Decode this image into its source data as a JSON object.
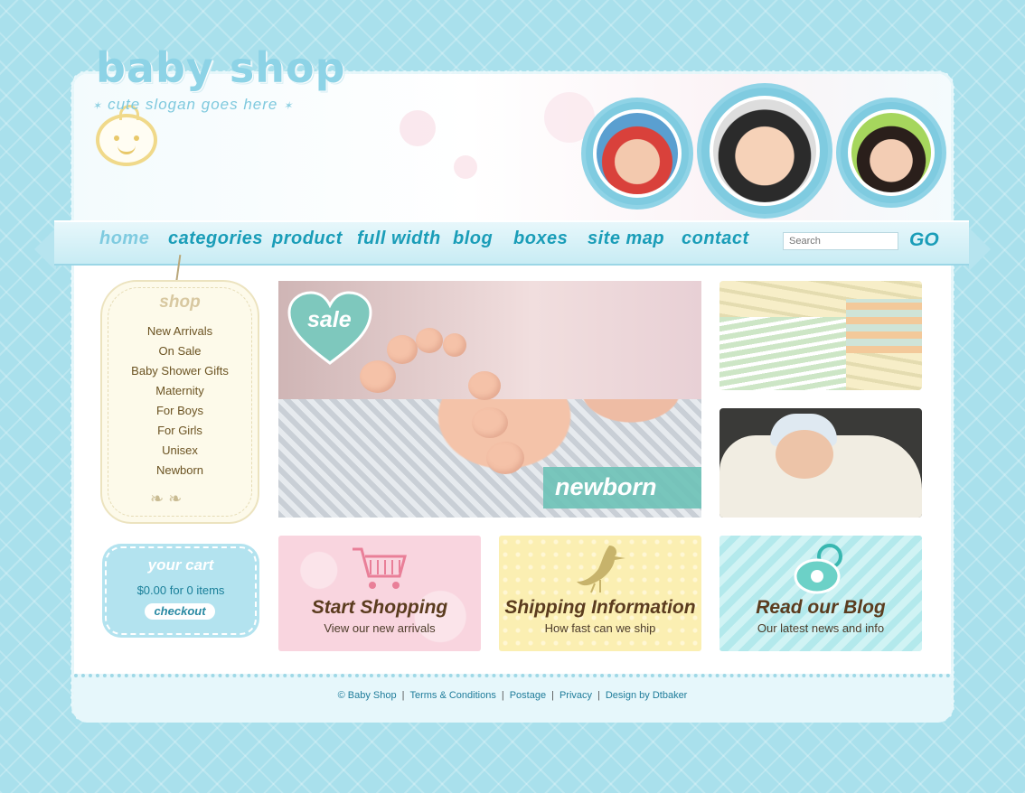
{
  "brand": {
    "title": "baby shop",
    "slogan": "cute slogan goes here"
  },
  "nav": {
    "items": [
      "home",
      "categories",
      "product",
      "full width",
      "blog",
      "boxes",
      "site map",
      "contact"
    ],
    "active": "home",
    "search_placeholder": "Search",
    "go_label": "GO"
  },
  "shop": {
    "title": "shop",
    "links": [
      "New Arrivals",
      "On Sale",
      "Baby Shower Gifts",
      "Maternity",
      "For Boys",
      "For Girls",
      "Unisex",
      "Newborn"
    ]
  },
  "cart": {
    "title": "your cart",
    "summary": "$0.00 for 0 items",
    "checkout_label": "checkout"
  },
  "hero": {
    "badge": "sale",
    "caption": "newborn"
  },
  "promos": [
    {
      "title": "Start Shopping",
      "subtitle": "View our new arrivals",
      "icon": "shopping-cart-icon"
    },
    {
      "title": "Shipping Information",
      "subtitle": "How fast can we ship",
      "icon": "stork-icon"
    },
    {
      "title": "Read our Blog",
      "subtitle": "Our latest news and info",
      "icon": "pacifier-icon"
    }
  ],
  "footer": {
    "links": [
      "© Baby Shop",
      "Terms & Conditions",
      "Postage",
      "Privacy",
      "Design by Dtbaker"
    ]
  },
  "colors": {
    "background": "#a9e0ec",
    "nav_text": "#1a9db8",
    "accent_teal": "#6fc2b7",
    "shop_text": "#6b5322"
  }
}
